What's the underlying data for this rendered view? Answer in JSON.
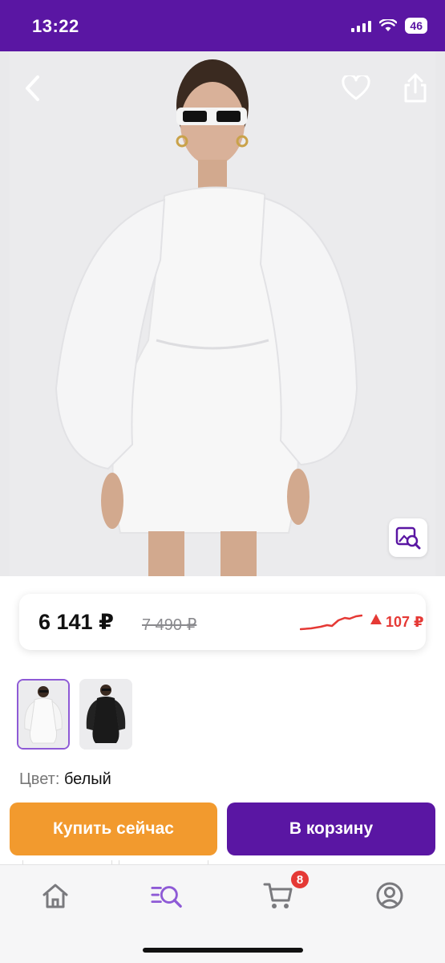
{
  "status_bar": {
    "time": "13:22",
    "network": "46"
  },
  "product": {
    "image_alt": "White jacquard mini dress with puff sleeves",
    "icons": {
      "back": "chevron-left-icon",
      "favorite": "heart-icon",
      "share": "share-icon",
      "image_search": "image-search-icon"
    }
  },
  "price": {
    "current": "6 141 ₽",
    "old": "7 490 ₽",
    "delta": "107 ₽",
    "delta_direction": "up",
    "trend_color": "#e53935"
  },
  "variants": {
    "items": [
      {
        "name": "белый",
        "swatch": "#f3f3f3",
        "selected": true
      },
      {
        "name": "черный",
        "swatch": "#1a1a1a",
        "selected": false
      }
    ]
  },
  "color": {
    "label": "Цвет:",
    "value": "белый"
  },
  "actions": {
    "buy_now": "Купить сейчас",
    "add_to_cart": "В корзину"
  },
  "bottom_nav": {
    "items": [
      {
        "name": "home",
        "icon": "home-icon",
        "active": false
      },
      {
        "name": "catalog",
        "icon": "search-list-icon",
        "active": true
      },
      {
        "name": "cart",
        "icon": "cart-icon",
        "active": false,
        "badge": "8"
      },
      {
        "name": "profile",
        "icon": "profile-icon",
        "active": false
      }
    ]
  },
  "colors": {
    "brand": "#5a16a3",
    "buy": "#f29a2e",
    "accent": "#8e5ad6",
    "alert": "#e53935"
  }
}
